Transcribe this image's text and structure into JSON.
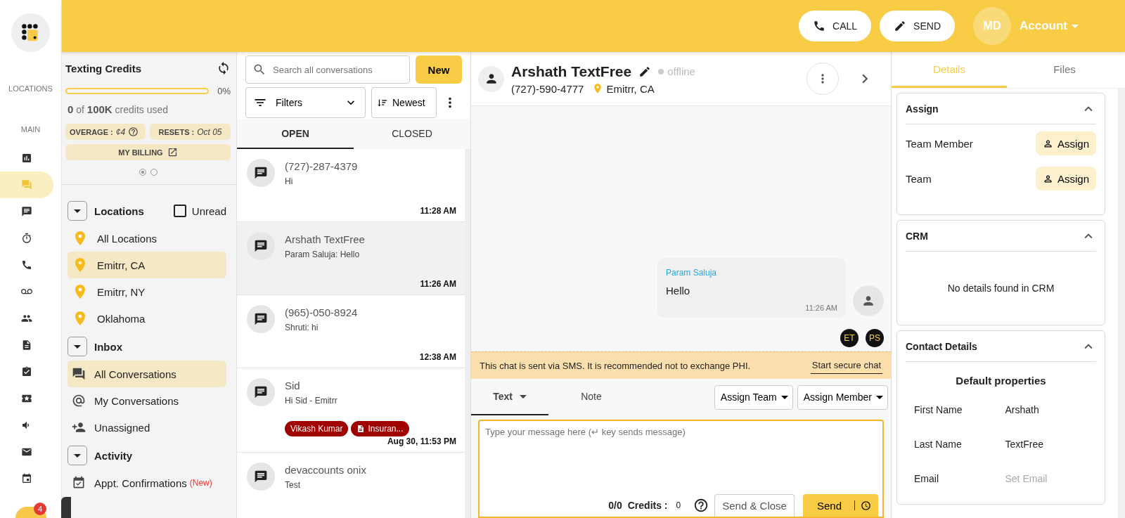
{
  "rail": {
    "labels": [
      "LOCATIONS",
      "MAIN"
    ],
    "items": [
      {
        "selected": false
      },
      {
        "selected": true
      },
      {
        "selected": false
      },
      {
        "selected": false
      },
      {
        "selected": false
      },
      {
        "selected": false
      },
      {
        "selected": false
      },
      {
        "selected": false
      },
      {
        "selected": false
      },
      {
        "selected": false
      },
      {
        "selected": false
      },
      {
        "selected": false
      },
      {
        "selected": false
      }
    ],
    "badge": "4"
  },
  "topbar": {
    "buttons": [
      {
        "label": "CALL",
        "kind": "call"
      },
      {
        "label": "SEND",
        "kind": "send"
      }
    ],
    "avatar": "MD",
    "account": "Account"
  },
  "credits": {
    "title": "Texting Credits",
    "level": 0,
    "percent": "0%",
    "usage": "**0** of **100K** credits used",
    "overage_label": "OVERAGE :",
    "overage_value": "¢4",
    "resets_label": "RESETS :",
    "resets_value": "Oct 05",
    "billing": "MY BILLING",
    "pages": [
      {
        "selected": true
      },
      {
        "selected": false
      }
    ]
  },
  "sections": [
    {
      "title": "Locations",
      "kind": "locations",
      "filter": {
        "label": "Unread",
        "checked": false
      },
      "items": [
        {
          "label": "All Locations",
          "selected": false
        },
        {
          "label": "Emitrr, CA",
          "selected": true
        },
        {
          "label": "Emitrr, NY",
          "selected": false
        },
        {
          "label": "Oklahoma",
          "selected": false
        }
      ]
    },
    {
      "title": "Inbox",
      "kind": "inbox",
      "items": [
        {
          "label": "All Conversations",
          "selected": true
        },
        {
          "label": "My Conversations",
          "selected": false
        },
        {
          "label": "Unassigned",
          "selected": false
        }
      ]
    },
    {
      "title": "Activity",
      "kind": "activity",
      "items": [
        {
          "label": "Appt. Confirmations",
          "badge": "(New)",
          "selected": false
        }
      ]
    }
  ],
  "list": {
    "search": {
      "placeholder": "Search all conversations"
    },
    "new_button": "New",
    "filters": "Filters",
    "sort": "Newest",
    "tabs": [
      {
        "label": "OPEN",
        "selected": true
      },
      {
        "label": "CLOSED",
        "selected": false
      }
    ],
    "conversations": [
      {
        "name": "(727)-287-4379",
        "preview": "Hi",
        "time": "11:28 AM",
        "selected": false
      },
      {
        "name": "Arshath TextFree",
        "preview": "Param Saluja: Hello",
        "time": "11:26 AM",
        "selected": true
      },
      {
        "name": "(965)-050-8924",
        "preview": "Shruti: hi",
        "time": "12:38 AM",
        "selected": false
      },
      {
        "name": "Sid",
        "preview": "Hi Sid - Emitrr",
        "time": "Aug 30, 11:53 PM",
        "selected": false,
        "tags": [
          {
            "label": "Vikash Kumar",
            "kind": "plain"
          },
          {
            "label": "Insuran...",
            "kind": "document"
          }
        ]
      },
      {
        "name": "devaccounts onix",
        "preview": "Test",
        "selected": false
      }
    ]
  },
  "chat": {
    "contact": {
      "name": "Arshath TextFree",
      "status": "offline",
      "phone": "(727)-590-4777",
      "location": "Emitrr, CA"
    },
    "messages": [
      {
        "sender": "Param Saluja",
        "text": "Hello",
        "time": "11:26 AM"
      }
    ],
    "participants": [
      "ET",
      "PS"
    ],
    "banner": {
      "text": "This chat is sent via SMS. It is recommended not to exchange PHI.",
      "action": "Start secure chat"
    },
    "compose": {
      "tabs": [
        {
          "label": "Text",
          "selected": true
        },
        {
          "label": "Note",
          "selected": false
        }
      ],
      "assign": [
        "Assign Team",
        "Assign Member"
      ],
      "placeholder": "Type your message here (↵ key sends message)",
      "counter": "0/0",
      "credits_label": "Credits :",
      "credits_value": "0",
      "secondary": "Send & Close",
      "primary": "Send"
    }
  },
  "details": {
    "tabs": [
      {
        "label": "Details",
        "selected": true
      },
      {
        "label": "Files",
        "selected": false
      }
    ],
    "cards": [
      {
        "title": "Assign",
        "kind": "assign",
        "expanded": true,
        "rows": [
          {
            "label": "Team Member",
            "action": "Assign"
          },
          {
            "label": "Team",
            "action": "Assign"
          }
        ]
      },
      {
        "title": "CRM",
        "kind": "empty",
        "expanded": true,
        "message": "No details found in CRM"
      },
      {
        "title": "Contact Details",
        "kind": "fields",
        "expanded": true,
        "subtitle": "Default properties",
        "fields": [
          {
            "label": "First Name",
            "value": "Arshath"
          },
          {
            "label": "Last Name",
            "value": "TextFree"
          },
          {
            "label": "Email",
            "placeholder": "Set Email"
          }
        ]
      }
    ]
  }
}
